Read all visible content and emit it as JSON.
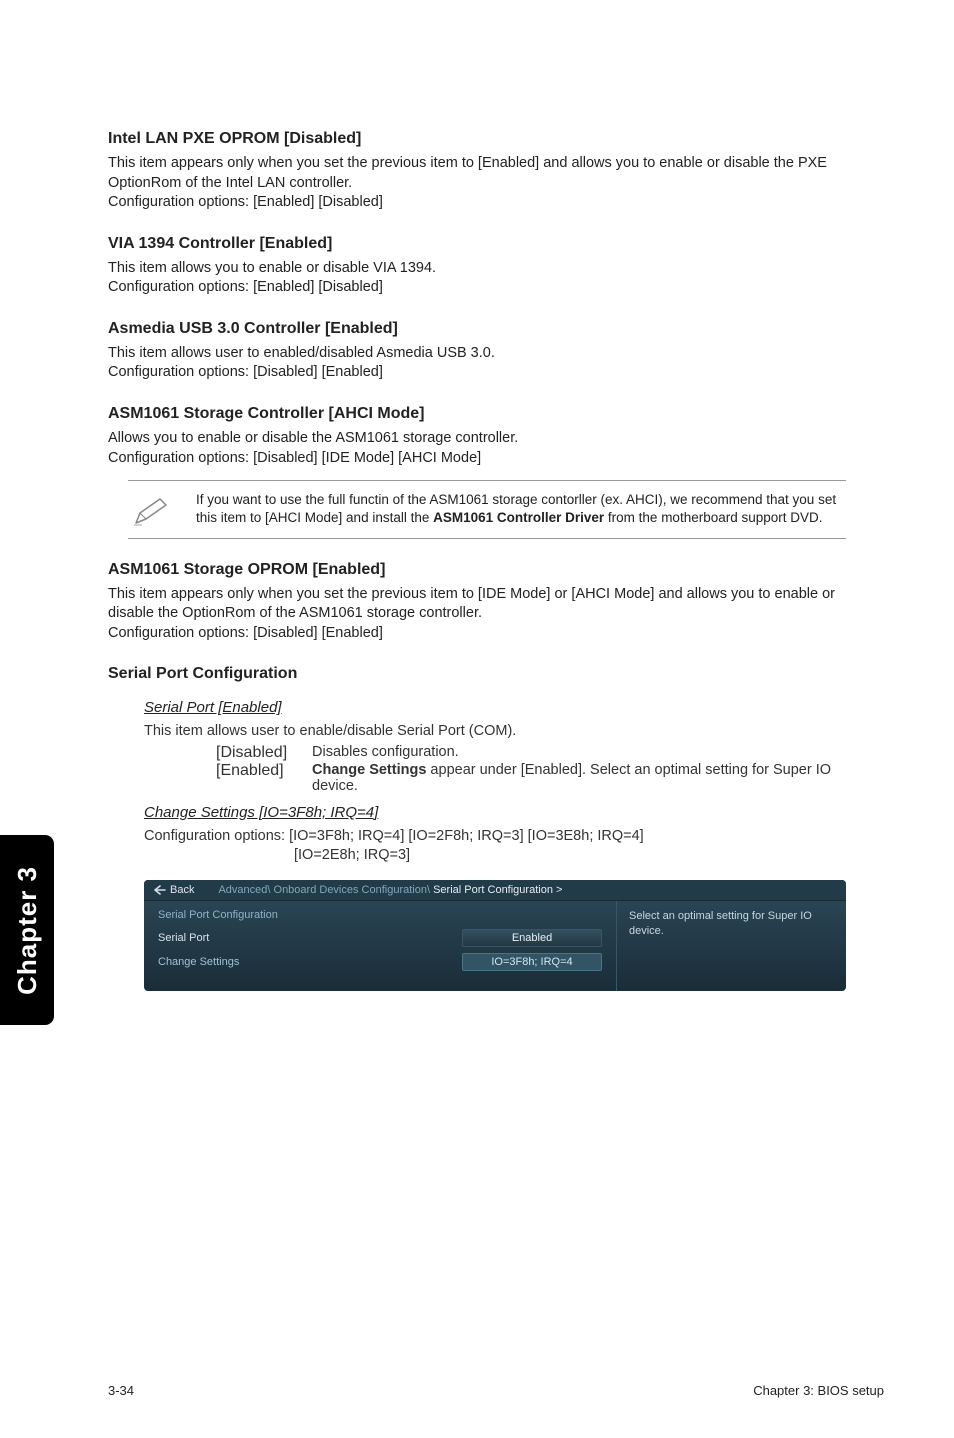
{
  "sections": {
    "s1": {
      "heading": "Intel LAN PXE OPROM [Disabled]",
      "desc": "This item appears only when you set the previous item to [Enabled] and allows you to enable or disable the PXE OptionRom of the Intel LAN controller.\nConfiguration options: [Enabled] [Disabled]"
    },
    "s2": {
      "heading": "VIA 1394 Controller [Enabled]",
      "desc": "This item allows you to enable or disable VIA 1394.\nConfiguration options: [Enabled] [Disabled]"
    },
    "s3": {
      "heading": "Asmedia USB 3.0 Controller [Enabled]",
      "desc": "This item allows user to enabled/disabled Asmedia USB 3.0.\nConfiguration options: [Disabled] [Enabled]"
    },
    "s4": {
      "heading": "ASM1061 Storage Controller [AHCI Mode]",
      "desc": "Allows you to enable or disable the ASM1061 storage controller.\nConfiguration options: [Disabled] [IDE Mode] [AHCI Mode]"
    },
    "note": {
      "pre": "If you want to use the full functin of the ASM1061 storage contorller (ex. AHCI), we recommend that you set this item to [AHCI Mode] and install the ",
      "bold": "ASM1061 Controller Driver",
      "post": " from the motherboard support DVD."
    },
    "s5": {
      "heading": "ASM1061 Storage OPROM [Enabled]",
      "desc": "This item appears only when you set the previous item to [IDE Mode] or [AHCI Mode] and allows you to enable or disable the OptionRom of the ASM1061 storage controller.\nConfiguration options: [Disabled] [Enabled]"
    },
    "s6": {
      "heading": "Serial Port Configuration",
      "sub1": {
        "title": "Serial Port [Enabled]",
        "intro": "This item allows user to enable/disable Serial Port (COM).",
        "opt_disabled_key": "[Disabled]",
        "opt_disabled_val": "Disables configuration.",
        "opt_enabled_key": "[Enabled]",
        "opt_enabled_bold": "Change Settings",
        "opt_enabled_rest": " appear under [Enabled]. Select an optimal setting for Super IO device."
      },
      "sub2": {
        "title": "Change Settings [IO=3F8h; IRQ=4]",
        "desc_l1": "Configuration options: [IO=3F8h; IRQ=4] [IO=2F8h; IRQ=3] [IO=3E8h; IRQ=4]",
        "desc_l2": "[IO=2E8h; IRQ=3]"
      }
    }
  },
  "bios": {
    "back_label": "Back",
    "breadcrumb_prefix": "Advanced\\ Onboard Devices Configuration\\ ",
    "breadcrumb_active": "Serial Port Configuration  >",
    "title": "Serial Port Configuration",
    "help": "Select an optimal setting for Super IO device.",
    "row1_label": "Serial Port",
    "row1_value": "Enabled",
    "row2_label": "Change Settings",
    "row2_value": "IO=3F8h; IRQ=4"
  },
  "chapter": "Chapter 3",
  "footer": {
    "left": "3-34",
    "right": "Chapter 3: BIOS setup"
  }
}
